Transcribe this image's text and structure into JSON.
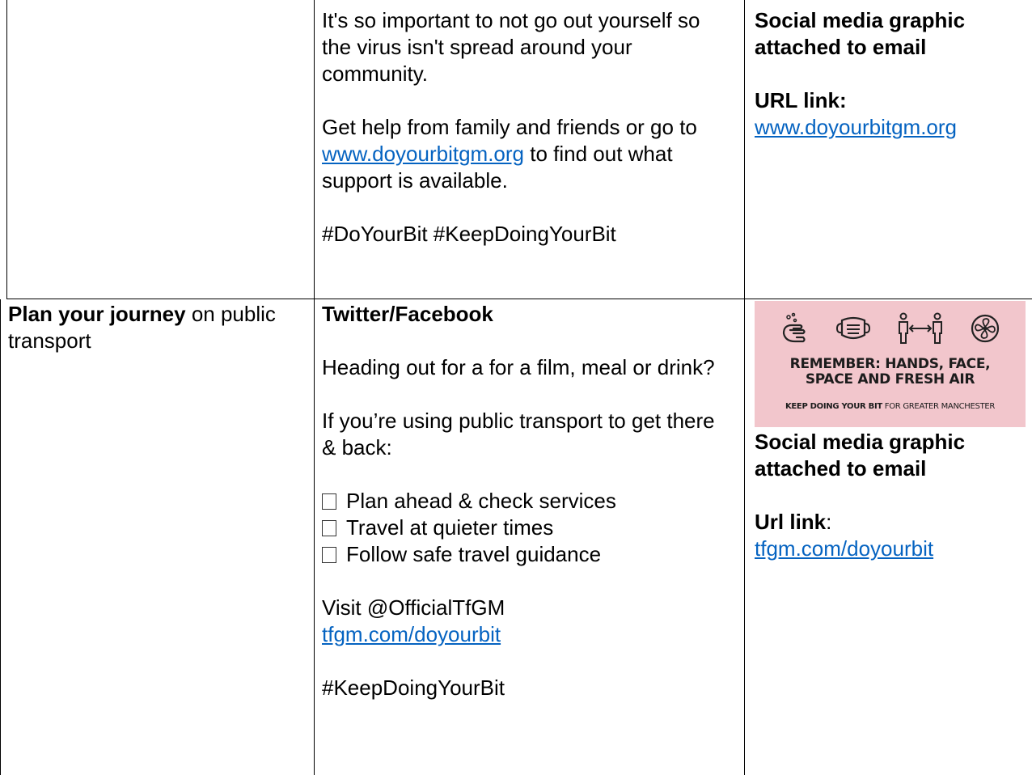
{
  "row1": {
    "message": {
      "p1": "It's so important to not go out yourself so the virus isn't spread around your community.",
      "p2_before": "Get help from family and friends or go to ",
      "p2_link": "www.doyourbitgm.org",
      "p2_after": " to find out what support is available.",
      "hashtags": "#DoYourBit #KeepDoingYourBit"
    },
    "assets": {
      "graphic_note": "Social media graphic attached to email",
      "url_label": "URL link:",
      "url": "www.doyourbitgm.org"
    }
  },
  "row2": {
    "topic": {
      "bold": "Plan your journey",
      "rest": " on public transport"
    },
    "message": {
      "channel": "Twitter/Facebook",
      "p1": "Heading out for a for a film, meal or drink?",
      "p2": "If you’re using public transport to get there & back:",
      "checklist": [
        "Plan ahead & check services",
        "Travel at quieter times",
        "Follow safe travel guidance"
      ],
      "visit": "Visit @OfficialTfGM",
      "link": "tfgm.com/doyourbit",
      "hashtag": "#KeepDoingYourBit"
    },
    "assets": {
      "graphic": {
        "line1": "REMEMBER: HANDS, FACE,",
        "line2": "SPACE AND FRESH AIR",
        "footer_bold": "KEEP DOING YOUR BIT",
        "footer_rest": " FOR GREATER MANCHESTER",
        "icons": [
          "handwash-icon",
          "face-mask-icon",
          "distance-icon",
          "fan-icon"
        ],
        "background": "#f2c6cc"
      },
      "graphic_note": "Social media graphic attached to email",
      "url_label": "Url link",
      "url_colon": ":",
      "url": "tfgm.com/doyourbit"
    }
  },
  "colors": {
    "link": "#0563c1",
    "border": "#000000"
  }
}
